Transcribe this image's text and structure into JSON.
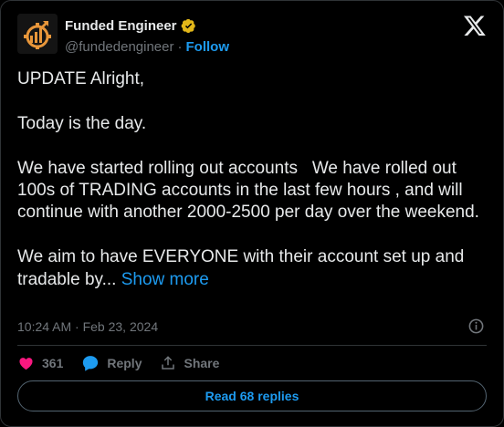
{
  "author": {
    "name": "Funded Engineer",
    "handle": "@fundedengineer",
    "separator": "·",
    "follow_label": "Follow"
  },
  "post": {
    "text": "UPDATE Alright,\n\nToday is the day.\n\nWe have started rolling out accounts   We have rolled out 100s of TRADING accounts in the last few hours , and will continue with another 2000-2500 per day over the weekend.\n\nWe aim to have EVERYONE with their account set up and tradable by... ",
    "show_more_label": "Show more",
    "timestamp": "10:24 AM · Feb 23, 2024"
  },
  "actions": {
    "likes": "361",
    "reply_label": "Reply",
    "share_label": "Share"
  },
  "read_replies_label": "Read 68 replies",
  "colors": {
    "accent": "#1d9bf0",
    "like": "#f91880",
    "verified": "#e2b719",
    "logo": "#e8963a"
  },
  "icons": {
    "avatar": "funded-engineer-logo",
    "verified": "verified-badge-icon",
    "close": "x-logo-icon",
    "info": "info-icon",
    "like": "heart-icon",
    "reply": "speech-bubble-icon",
    "share": "share-upload-icon"
  }
}
